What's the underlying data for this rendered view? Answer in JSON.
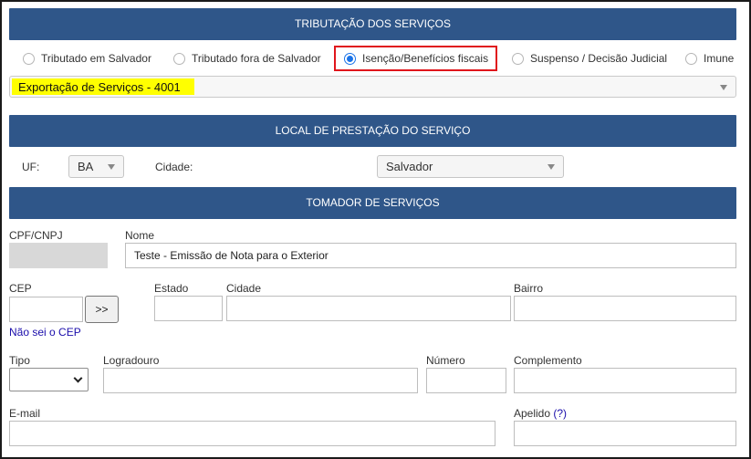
{
  "tributacao": {
    "header": "TRIBUTAÇÃO DOS SERVIÇOS",
    "options": [
      {
        "label": "Tributado em Salvador",
        "checked": false
      },
      {
        "label": "Tributado fora de Salvador",
        "checked": false
      },
      {
        "label": "Isenção/Benefícios fiscais",
        "checked": true
      },
      {
        "label": "Suspenso / Decisão Judicial",
        "checked": false
      },
      {
        "label": "Imune",
        "checked": false
      }
    ],
    "selected_benefit": "Exportação de Serviços - 4001"
  },
  "local": {
    "header": "LOCAL DE PRESTAÇÃO DO SERVIÇO",
    "uf_label": "UF:",
    "uf_value": "BA",
    "cidade_label": "Cidade:",
    "cidade_value": "Salvador"
  },
  "tomador": {
    "header": "TOMADOR DE SERVIÇOS",
    "cpf_label": "CPF/CNPJ",
    "cpf_value": "",
    "nome_label": "Nome",
    "nome_value": "Teste - Emissão de Nota para o Exterior",
    "cep_label": "CEP",
    "cep_button": ">>",
    "cep_link": "Não sei o CEP",
    "estado_label": "Estado",
    "cidade_label": "Cidade",
    "bairro_label": "Bairro",
    "tipo_label": "Tipo",
    "logradouro_label": "Logradouro",
    "numero_label": "Número",
    "complemento_label": "Complemento",
    "email_label": "E-mail",
    "apelido_label": "Apelido",
    "apelido_help": "(?)"
  }
}
